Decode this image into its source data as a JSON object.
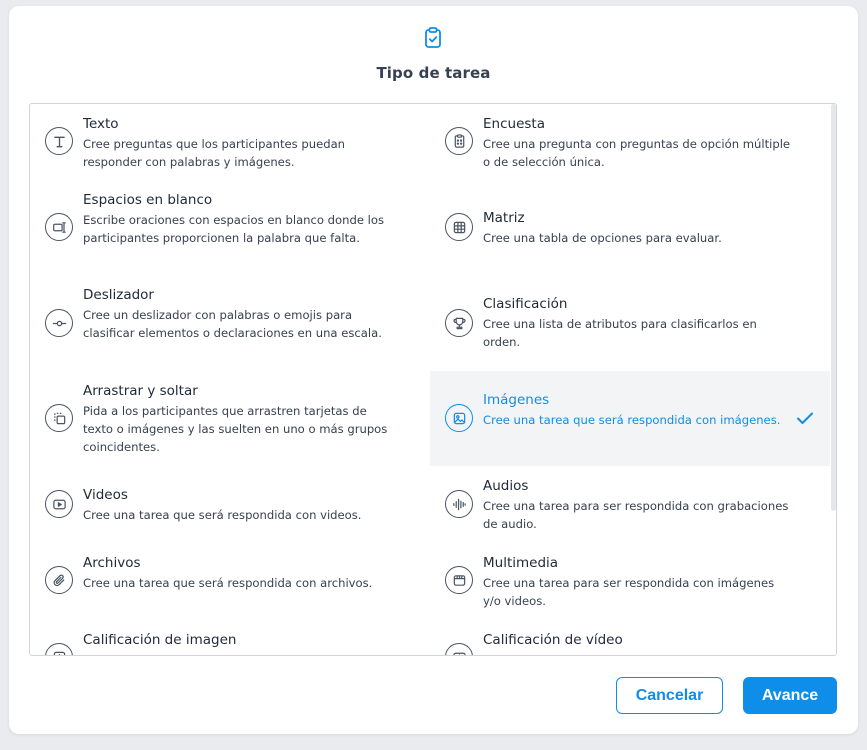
{
  "modal": {
    "title": "Tipo de tarea",
    "header_icon": "clipboard-check-icon",
    "accent_color": "#0e8ee8",
    "selected_task": "Imágenes",
    "tasks": [
      {
        "name": "Texto",
        "description": "Cree preguntas que los participantes puedan responder con palabras y imágenes.",
        "icon": "text-icon"
      },
      {
        "name": "Encuesta",
        "description": "Cree una pregunta con preguntas de opción múltiple o de selección única.",
        "icon": "survey-icon"
      },
      {
        "name": "Espacios en blanco",
        "description": "Escribe oraciones con espacios en blanco donde los participantes proporcionen la palabra que falta.",
        "icon": "fill-blank-icon"
      },
      {
        "name": "Matriz",
        "description": "Cree una tabla de opciones para evaluar.",
        "icon": "matrix-icon"
      },
      {
        "name": "Deslizador",
        "description": "Cree un deslizador con palabras o emojis para clasificar elementos o declaraciones en una escala.",
        "icon": "slider-icon"
      },
      {
        "name": "Clasificación",
        "description": "Cree una lista de atributos para clasificarlos en orden.",
        "icon": "trophy-icon"
      },
      {
        "name": "Arrastrar y soltar",
        "description": "Pida a los participantes que arrastren tarjetas de texto o imágenes y las suelten en uno o más grupos coincidentes.",
        "icon": "drag-drop-icon"
      },
      {
        "name": "Imágenes",
        "description": "Cree una tarea que será respondida con imágenes.",
        "icon": "image-icon"
      },
      {
        "name": "Videos",
        "description": "Cree una tarea que será respondida con videos.",
        "icon": "video-icon"
      },
      {
        "name": "Audios",
        "description": "Cree una tarea para ser respondida con grabaciones de audio.",
        "icon": "audio-wave-icon"
      },
      {
        "name": "Archivos",
        "description": "Cree una tarea que será respondida con archivos.",
        "icon": "paperclip-icon"
      },
      {
        "name": "Multimedia",
        "description": "Cree una tarea para ser respondida con imágenes y/o videos.",
        "icon": "multimedia-icon"
      },
      {
        "name": "Calificación de imagen",
        "description": "",
        "icon": "image-rating-icon"
      },
      {
        "name": "Calificación de vídeo",
        "description": "",
        "icon": "video-rating-icon"
      }
    ]
  },
  "footer": {
    "cancel_label": "Cancelar",
    "next_label": "Avance"
  }
}
